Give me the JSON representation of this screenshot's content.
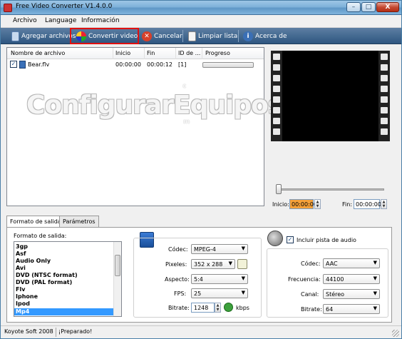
{
  "window": {
    "title": "Free Video Converter V1.4.0.0"
  },
  "window_controls": {
    "min": "–",
    "max": "□",
    "close": "X"
  },
  "menu": {
    "items": [
      "Archivo",
      "Language",
      "Información"
    ]
  },
  "toolbar": {
    "add_files": "Agregar archivos",
    "convert": "Convertir video",
    "cancel": "Cancelar",
    "clear_list": "Limpiar lista",
    "about": "Acerca de",
    "icons": {
      "add_files": "add-files-icon",
      "convert": "convert-icon",
      "cancel": "cancel-icon",
      "clear_list": "clear-list-icon",
      "about": "info-icon"
    },
    "colors": {
      "bar": "#2e5680",
      "highlight": "#e01010"
    }
  },
  "file_list": {
    "columns": [
      "Nombre de archivo",
      "Inicio",
      "Fin",
      "ID de ...",
      "Progreso"
    ],
    "rows": [
      {
        "checked": true,
        "name": "Bear.flv",
        "start": "00:00:00",
        "end": "00:00:12",
        "id": "[1]",
        "progress": 0
      }
    ]
  },
  "watermark": {
    "text": "ConfigurarEquipos",
    "small_1": "c",
    "small_2": "m"
  },
  "preview": {
    "slider_position": 0,
    "start_label": "Inicio:",
    "start_value": "00:00:00",
    "end_label": "Fin:",
    "end_value": "00:00:00",
    "spin_up": "▲",
    "spin_down": "▼"
  },
  "tabs": [
    "Formato de salida",
    "Parámetros"
  ],
  "output": {
    "format_label": "Formato de salida:",
    "formats": [
      "3gp",
      "Asf",
      "Audio Only",
      "Avi",
      "DVD (NTSC format)",
      "DVD (PAL format)",
      "Flv",
      "Iphone",
      "Ipod",
      "Mp4"
    ],
    "selected_format": "Mp4"
  },
  "video": {
    "codec_label": "Códec:",
    "codec": "MPEG-4",
    "pixels_label": "Pixeles:",
    "pixels": "352 x 288",
    "aspect_label": "Aspecto:",
    "aspect": "5:4",
    "fps_label": "FPS:",
    "fps": "25",
    "bitrate_label": "Bitrate:",
    "bitrate": "1248",
    "bitrate_unit": "kbps",
    "dropdown_arrow": "▼"
  },
  "audio": {
    "include_label": "Incluir pista de audio",
    "include_checked": true,
    "codec_label": "Códec:",
    "codec": "AAC",
    "freq_label": "Frecuencia:",
    "freq": "44100",
    "channel_label": "Canal:",
    "channel": "Stéreo",
    "bitrate_label": "Bitrate:",
    "bitrate": "64"
  },
  "status": {
    "company": "Koyote Soft 2008",
    "message": "¡Preparado!"
  }
}
